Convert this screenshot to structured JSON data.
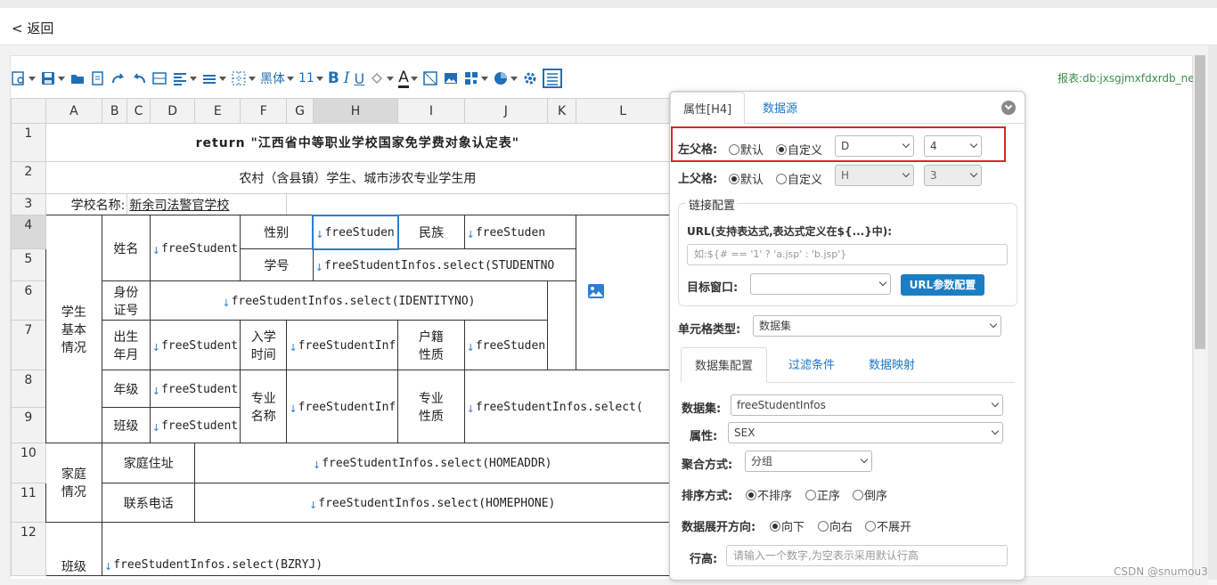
{
  "topbar": {
    "back_label": "< 返回"
  },
  "toolbar": {
    "font_name": "黑体",
    "font_size": "11",
    "bold": "B",
    "italic": "I",
    "underline": "U",
    "font_color": "A"
  },
  "report_label": "报表:db:jxsgjmxfdxrdb_new",
  "sheet": {
    "columns": [
      "A",
      "B",
      "C",
      "D",
      "E",
      "F",
      "G",
      "H",
      "I",
      "J",
      "K",
      "L"
    ],
    "rows": [
      "1",
      "2",
      "3",
      "4",
      "5",
      "6",
      "7",
      "8",
      "9",
      "10",
      "11",
      "12"
    ],
    "cells": {
      "title": "return \"江西省中等职业学校国家免学费对象认定表\"",
      "subtitle": "农村（含县镇）学生、城市涉农专业学生用",
      "school_label": "学校名称:",
      "school_value": "新余司法警官学校",
      "student_basic": "学生\n基本\n情况",
      "name": "姓名",
      "gender": "性别",
      "ethnic": "民族",
      "student_no": "学号",
      "id_no": "身份\n证号",
      "birth": "出生\n年月",
      "enroll": "入学\n时间",
      "hukou": "户籍\n性质",
      "grade": "年级",
      "major": "专业\n名称",
      "major_nature": "专业\n性质",
      "class": "班级",
      "family": "家庭\n情况",
      "address": "家庭住址",
      "phone": "联系电话",
      "class_bottom": "班级",
      "f_student": "freeStudent",
      "f_studen_short": "freeStuden",
      "f_studentinf": "freeStudentInf",
      "f_sno": "freeStudentInfos.select(STUDENTNO",
      "f_id": "freeStudentInfos.select(IDENTITYNO)",
      "f_major_nature": "freeStudentInfos.select(",
      "f_addr": "freeStudentInfos.select(HOMEADDR)",
      "f_phone": "freeStudentInfos.select(HOMEPHONE)",
      "f_bzryj": "freeStudentInfos.select(BZRYJ)"
    }
  },
  "attr_panel": {
    "tab_props": "属性[H4]",
    "tab_datasource": "数据源",
    "left_parent_label": "左父格:",
    "top_parent_label": "上父格:",
    "default_opt": "默认",
    "custom_opt": "自定义",
    "left_col": "D",
    "left_row": "4",
    "top_col": "H",
    "top_row": "3",
    "link_config": "链接配置",
    "url_label": "URL(支持表达式,表达式定义在${...}中):",
    "url_placeholder": "如:${# == '1' ? 'a.jsp' : 'b.jsp'}",
    "target_label": "目标窗口:",
    "target_value": "",
    "url_param_btn": "URL参数配置",
    "cell_type_label": "单元格类型:",
    "cell_type_value": "数据集",
    "subtab_dataset": "数据集配置",
    "subtab_filter": "过滤条件",
    "subtab_mapping": "数据映射",
    "dataset_label": "数据集:",
    "dataset_value": "freeStudentInfos",
    "property_label": "属性:",
    "property_value": "SEX",
    "agg_label": "聚合方式:",
    "agg_value": "分组",
    "sort_label": "排序方式:",
    "sort_none": "不排序",
    "sort_asc": "正序",
    "sort_desc": "倒序",
    "expand_label": "数据展开方向:",
    "expand_down": "向下",
    "expand_right": "向右",
    "expand_none": "不展开",
    "rowheight_label": "行高:",
    "rowheight_placeholder": "请输入一个数字,为空表示采用默认行高"
  },
  "watermark": "CSDN @snumou3",
  "colors": {
    "accent": "#1b7ec2",
    "highlight": "#d9262a",
    "report_green": "#3a8e4c"
  }
}
